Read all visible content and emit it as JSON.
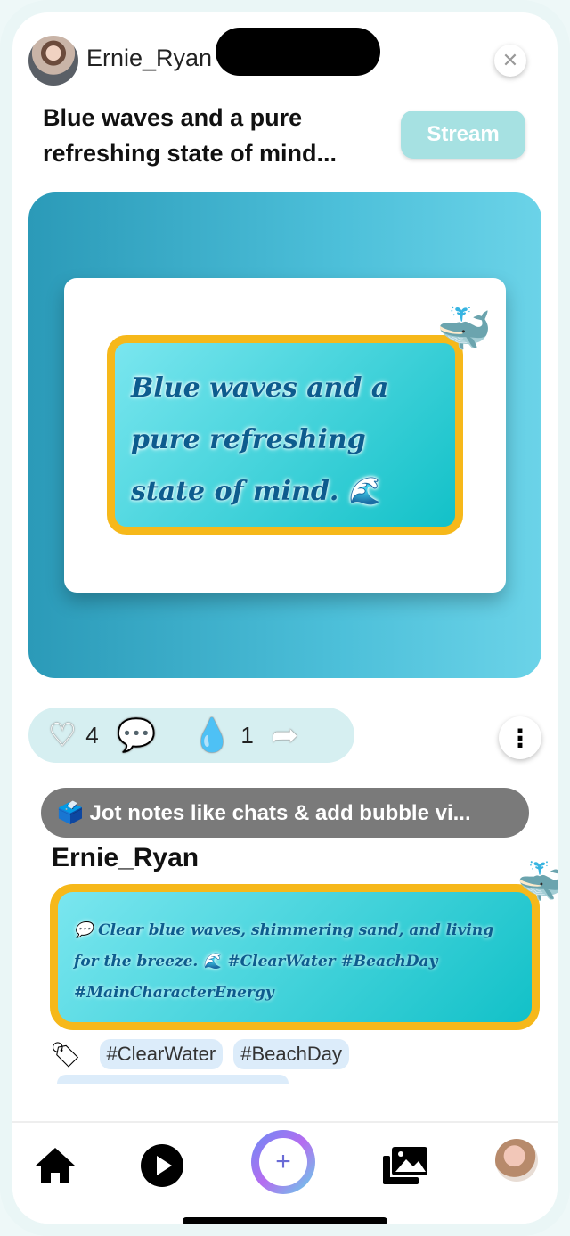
{
  "header": {
    "username": "Ernie_Ryan",
    "close_icon": "✕",
    "title": "Blue waves and a pure refreshing state of mind...",
    "stream_label": "Stream"
  },
  "hero": {
    "note_text": "Blue waves and a pure refreshing state of mind. 🌊",
    "whale_emoji": "🐳"
  },
  "actions": {
    "likes": "4",
    "drops": "1"
  },
  "tip": {
    "text": "🗳️ Jot notes like chats & add bubble vi..."
  },
  "post": {
    "username": "Ernie_Ryan",
    "caption": "💬 Clear blue waves, shimmering sand, and living for the breeze. 🌊 #ClearWater #BeachDay #MainCharacterEnergy",
    "whale_emoji": "🐳",
    "tags": [
      "#ClearWater",
      "#BeachDay"
    ]
  },
  "tabbar": {
    "items": [
      "home-icon",
      "play-icon",
      "create-icon",
      "gallery-icon",
      "profile-avatar"
    ]
  }
}
